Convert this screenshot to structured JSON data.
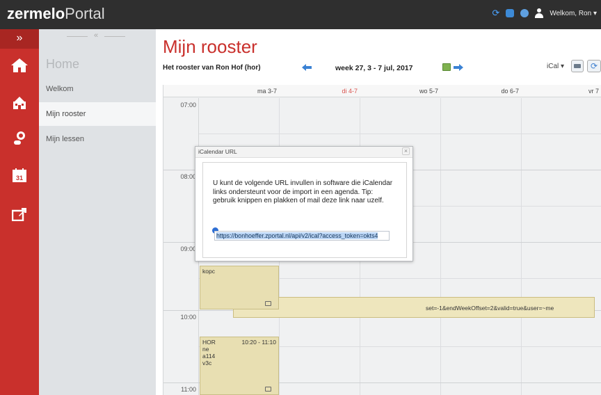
{
  "app": {
    "logo_bold": "zermelo",
    "logo_light": "Portal"
  },
  "topbar": {
    "user_label": "Welkom, Ron"
  },
  "iconbar": {
    "collapse_glyph": "»",
    "icons": [
      "home-icon",
      "school-icon",
      "person-search-icon",
      "calendar-icon",
      "share-icon"
    ],
    "calendar_day": "31"
  },
  "nav": {
    "collapse_glyph": "«",
    "home_label": "Home",
    "items": [
      {
        "label": "Welkom"
      },
      {
        "label": "Mijn rooster"
      },
      {
        "label": "Mijn lessen"
      }
    ]
  },
  "main": {
    "title": "Mijn rooster",
    "schedule_owner": "Het rooster van Ron Hof (hor)",
    "week_label": "week 27, 3 - 7 jul, 2017",
    "ical_label": "iCal ▾",
    "days": [
      "ma 3-7",
      "di 4-7",
      "wo 5-7",
      "do 6-7",
      "vr 7"
    ],
    "times": [
      "07:00",
      "08:00",
      "09:00",
      "10:00",
      "11:00"
    ]
  },
  "lessons": [
    {
      "text": "kopc"
    },
    {
      "teacher": "HOR",
      "time": "10:20 - 11:10",
      "line2": "ne",
      "line3": "a114",
      "line4": "v3c"
    }
  ],
  "background_url_fragment": "set=-1&endWeekOffset=2&valid=true&user=~me",
  "modal": {
    "title": "iCalendar URL",
    "close": "×",
    "text": "U kunt de volgende URL invullen in software die iCalendar links ondersteunt voor de import in een agenda. Tip: gebruik knippen en plakken of mail deze link naar uzelf.",
    "url": "https://bonhoeffer.zportal.nl/api/v2/ical?access_token=okts4"
  },
  "colors": {
    "accent": "#c9302c",
    "topbar": "#2f2f2f",
    "lesson": "#e8dfb2"
  }
}
